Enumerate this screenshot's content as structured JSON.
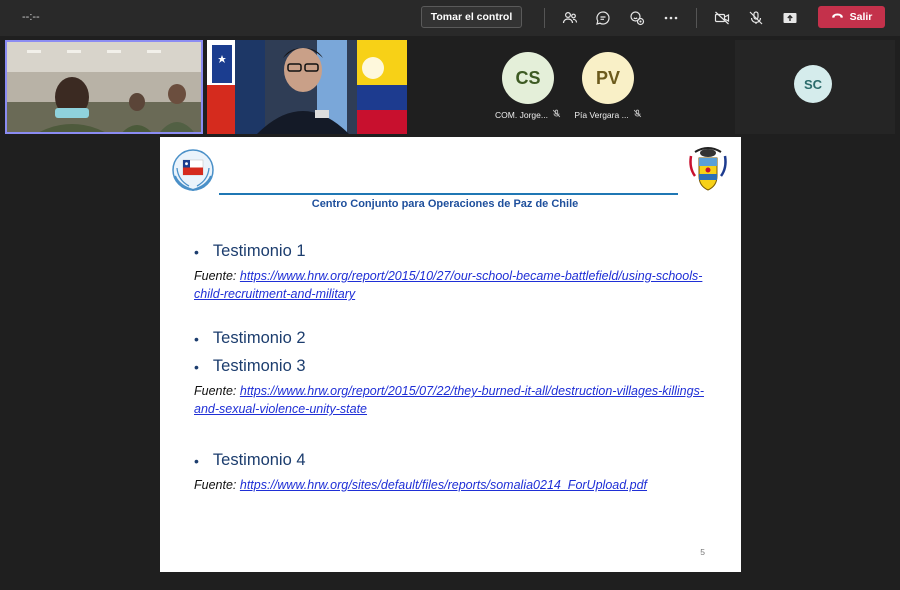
{
  "topbar": {
    "timer": "--:--",
    "take_control_label": "Tomar el control",
    "leave_label": "Salir",
    "icons": [
      "people-icon",
      "chat-icon",
      "reactions-icon",
      "more-icon",
      "camera-off-icon",
      "mic-off-icon",
      "share-icon",
      "phone-icon"
    ]
  },
  "participants": [
    {
      "initials": "CS",
      "name": "COM. Jorge..."
    },
    {
      "initials": "PV",
      "name": "Pía Vergara ..."
    },
    {
      "initials": "SC"
    }
  ],
  "slide": {
    "heading": "Centro Conjunto para Operaciones de Paz de Chile",
    "items": [
      {
        "title": "Testimonio 1",
        "source_label": "Fuente: ",
        "link": "https://www.hrw.org/report/2015/10/27/our-school-became-battlefield/using-schools-child-recruitment-and-military"
      },
      {
        "title": "Testimonio 2"
      },
      {
        "title": "Testimonio 3",
        "source_label": "Fuente: ",
        "link": "https://www.hrw.org/report/2015/07/22/they-burned-it-all/destruction-villages-killings-and-sexual-violence-unity-state"
      },
      {
        "title": "Testimonio 4",
        "source_label": "Fuente: ",
        "link": "https://www.hrw.org/sites/default/files/reports/somalia0214_ForUpload.pdf"
      }
    ],
    "page_number": "5"
  },
  "colors": {
    "leave": "#c4314b",
    "active_speaker_border": "#8b8cf2",
    "slide_rule": "#1f77b4",
    "link": "#1f2fd6"
  }
}
